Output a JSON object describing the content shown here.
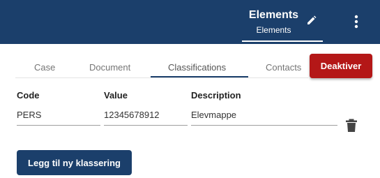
{
  "header": {
    "title": "Elements",
    "subtitle": "Elements",
    "edit_icon": "pencil-icon",
    "menu_icon": "more-vertical-icon"
  },
  "tabs": [
    {
      "label": "Case"
    },
    {
      "label": "Document"
    },
    {
      "label": "Classifications",
      "active": true
    },
    {
      "label": "Contacts"
    }
  ],
  "actions": {
    "deactivate_label": "Deaktiver",
    "add_label": "Legg til ny klassering"
  },
  "table": {
    "columns": [
      "Code",
      "Value",
      "Description"
    ],
    "rows": [
      {
        "code": "PERS",
        "value": "12345678912",
        "description": "Elevmappe"
      }
    ],
    "delete_icon": "trash-icon"
  },
  "colors": {
    "header_bg": "#1b3f6b",
    "primary_button": "#1b3f6b",
    "danger_button": "#b41717"
  }
}
